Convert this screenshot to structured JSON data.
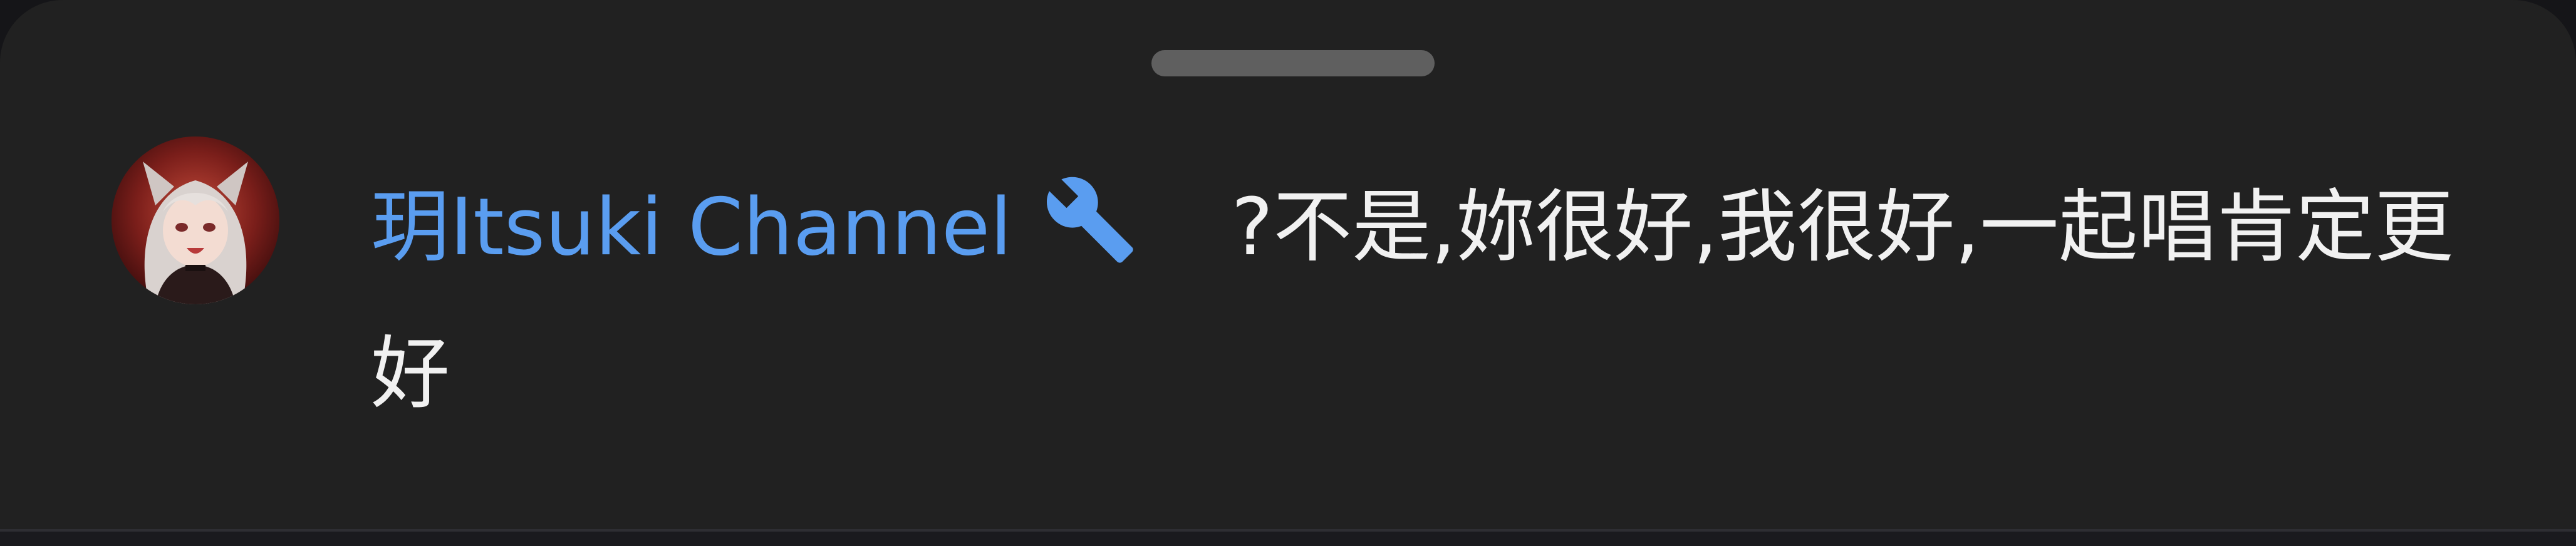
{
  "colors": {
    "sheet_background": "#212121",
    "author_name": "#5a9df0",
    "message_text": "#f1f1f1",
    "drag_handle": "#5f5f5f",
    "moderator_icon": "#5a9df0"
  },
  "handle": {
    "icon": "drag-handle"
  },
  "comment": {
    "avatar_icon": "avatar",
    "author_name": "玥Itsuki Channel",
    "badge_icon": "wrench-icon",
    "text": "?不是,妳很好,我很好,一起唱肯定更好"
  }
}
